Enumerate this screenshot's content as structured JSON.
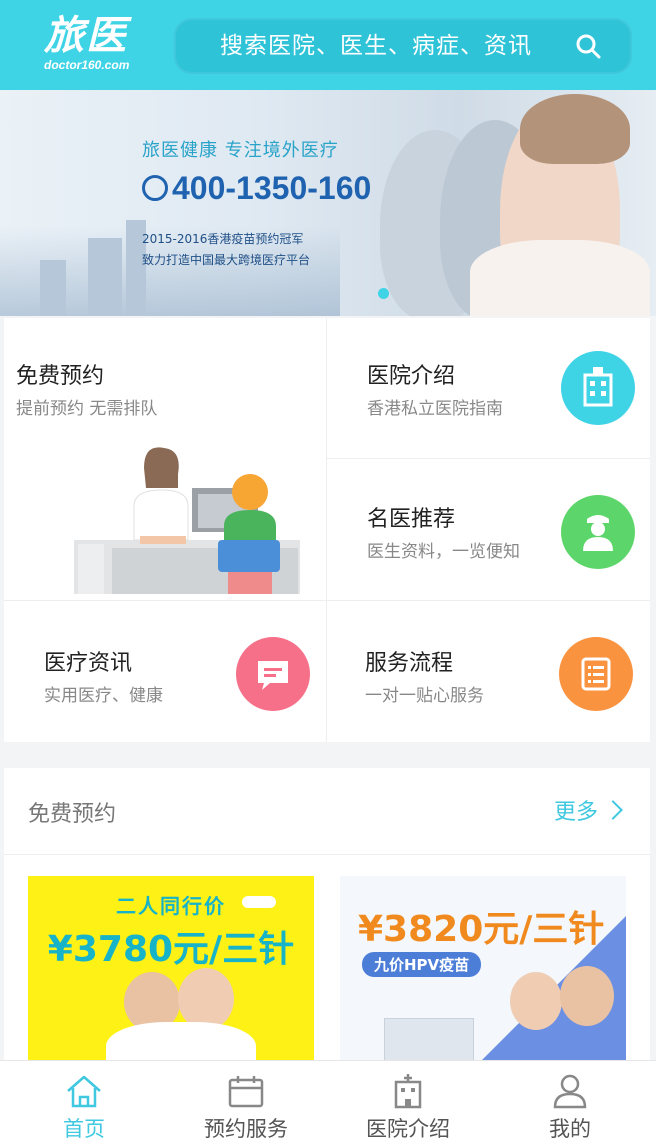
{
  "header": {
    "logo_text": "旅医",
    "logo_sub": "doctor160.com",
    "search_placeholder": "搜索医院、医生、病症、资讯"
  },
  "banner": {
    "tagline": "旅医健康  专注境外医疗",
    "phone": "400-1350-160",
    "line1": "2015-2016香港疫苗预约冠军",
    "line2": "致力打造中国最大跨境医疗平台"
  },
  "grid": {
    "appointment": {
      "title": "免费预约",
      "subtitle": "提前预约 无需排队"
    },
    "hospital": {
      "title": "医院介绍",
      "subtitle": "香港私立医院指南",
      "color": "#3fd3e6"
    },
    "doctors": {
      "title": "名医推荐",
      "subtitle": "医生资料，一览便知",
      "color": "#5cd66a"
    },
    "news": {
      "title": "医疗资讯",
      "subtitle": "实用医疗、健康",
      "color": "#f7708a"
    },
    "process": {
      "title": "服务流程",
      "subtitle": "一对一贴心服务",
      "color": "#fa9340"
    }
  },
  "section": {
    "title": "免费预约",
    "more": "更多",
    "promo1": {
      "top": "二人同行价",
      "price": "¥3780元/三针"
    },
    "promo2": {
      "price": "¥3820元/三针",
      "badge": "九价HPV疫苗"
    }
  },
  "tabbar": {
    "items": [
      {
        "label": "首页",
        "icon": "home-icon",
        "active": true
      },
      {
        "label": "预约服务",
        "icon": "calendar-icon",
        "active": false
      },
      {
        "label": "医院介绍",
        "icon": "hospital-icon",
        "active": false
      },
      {
        "label": "我的",
        "icon": "user-icon",
        "active": false
      }
    ],
    "accent": "#3fc8e0"
  }
}
